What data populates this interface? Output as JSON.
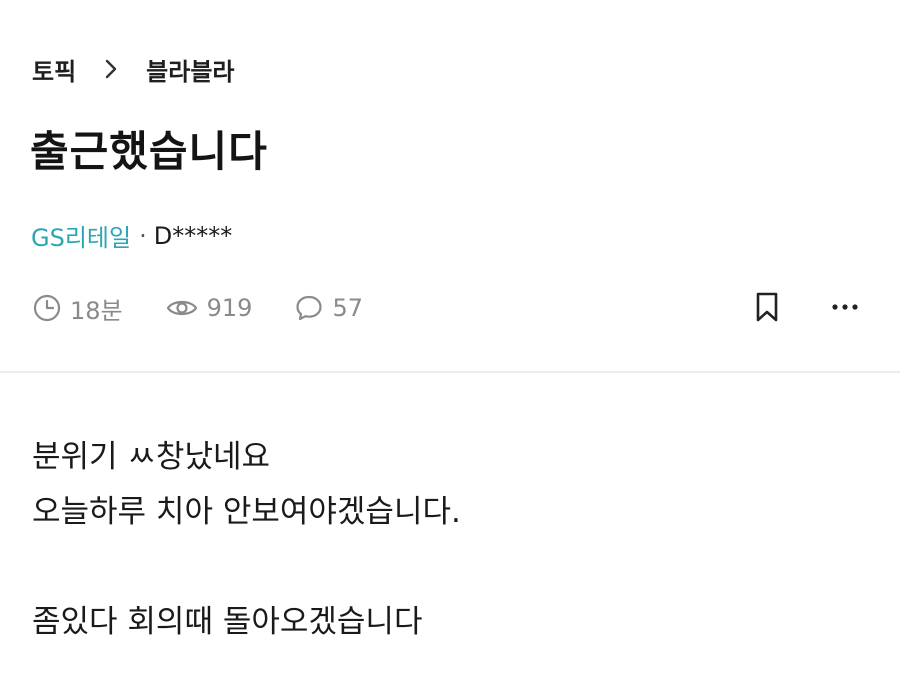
{
  "breadcrumb": {
    "topic": "토픽",
    "board": "블라블라"
  },
  "post": {
    "title": "출근했습니다",
    "company": "GS리테일",
    "separator": "·",
    "author": "D*****",
    "time_ago": "18분",
    "views": "919",
    "comments": "57",
    "body": [
      "분위기 ㅆ창났네요",
      "오늘하루 치아 안보여야겠습니다.",
      "",
      "좀있다 회의때 돌아오겠습니다"
    ]
  },
  "icons": {
    "chevron": "chevron-right-icon",
    "time": "clock-icon",
    "views": "eye-icon",
    "comments": "speech-bubble-icon",
    "bookmark": "bookmark-icon",
    "more": "more-horizontal-icon"
  },
  "colors": {
    "company": "#2aa7b3",
    "meta": "#8a8a8a",
    "text": "#1a1a1a"
  }
}
